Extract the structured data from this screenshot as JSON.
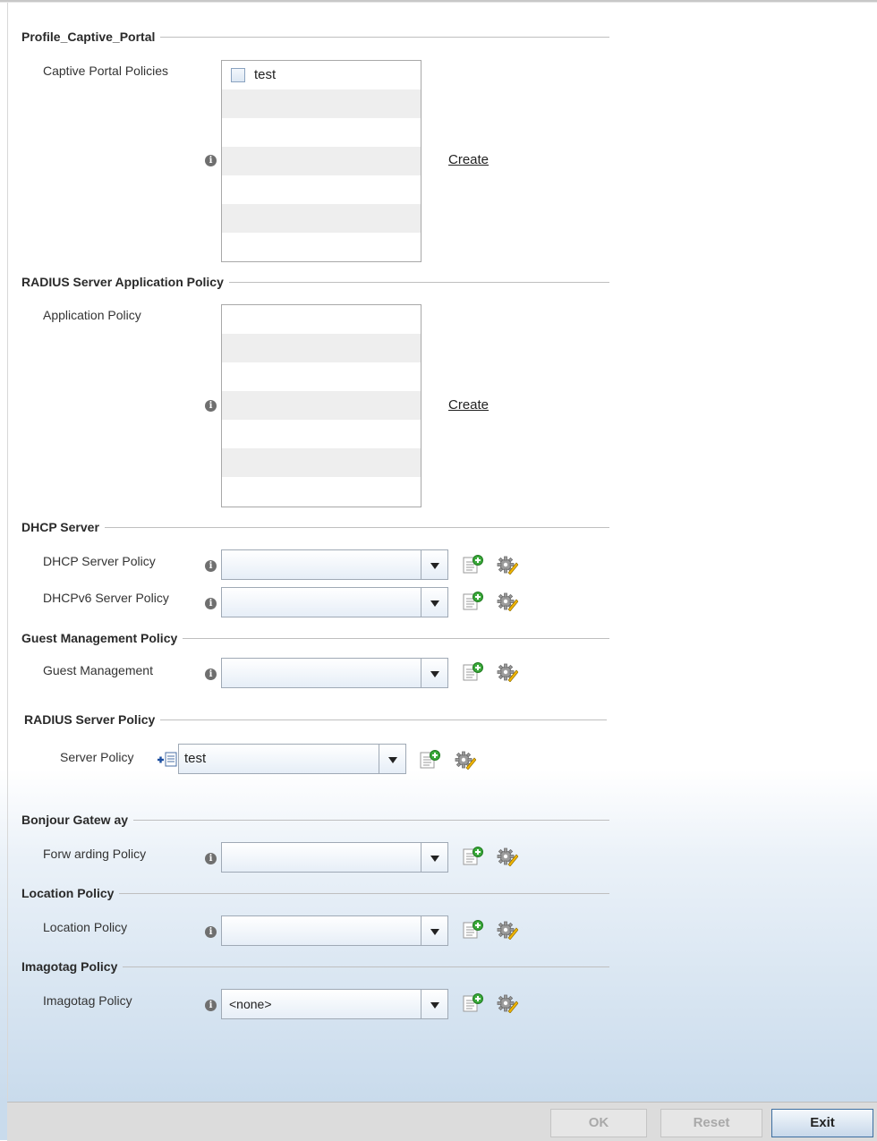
{
  "sections": {
    "captive_portal": {
      "title": "Profile_Captive_Portal",
      "label": "Captive Portal Policies",
      "items": [
        "test"
      ],
      "create_link": "Create"
    },
    "radius_app": {
      "title": "RADIUS Server Application Policy",
      "label": "Application Policy",
      "create_link": "Create"
    },
    "dhcp": {
      "title": "DHCP Server",
      "server_policy_label": "DHCP Server Policy",
      "server_policy_value": "",
      "v6_policy_label": "DHCPv6 Server Policy",
      "v6_policy_value": ""
    },
    "guest": {
      "title": "Guest Management Policy",
      "label": "Guest Management",
      "value": ""
    },
    "radius_server": {
      "title": "RADIUS Server Policy",
      "label": "Server Policy",
      "value": "test"
    },
    "bonjour": {
      "title": "Bonjour Gatew ay",
      "label": "Forw arding Policy",
      "value": ""
    },
    "location": {
      "title": "Location Policy",
      "label": "Location Policy",
      "value": ""
    },
    "imagotag": {
      "title": "Imagotag Policy",
      "label": "Imagotag Policy",
      "value": "<none>"
    }
  },
  "footer": {
    "ok_label": "OK",
    "reset_label": "Reset",
    "exit_label": "Exit"
  },
  "colors": {
    "exit_border": "#3c6ea0",
    "info_icon": "#6f6f6f"
  },
  "icons": {
    "info": "info-icon",
    "create": "add-document-icon",
    "edit": "gear-edit-icon",
    "override": "override-icon"
  }
}
